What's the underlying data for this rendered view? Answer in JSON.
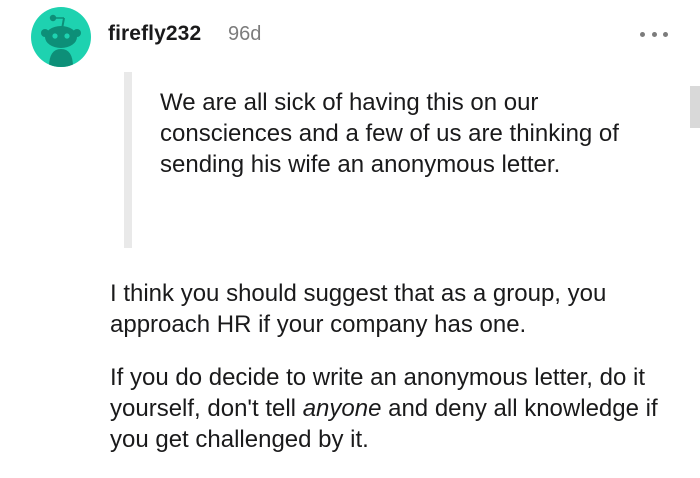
{
  "comment": {
    "username": "firefly232",
    "age": "96d",
    "avatar_icon": "snoo-avatar-icon",
    "avatar_color": "#1ed2b0",
    "more_icon": "more-options-icon",
    "quote": "We are all sick of having this on our consciences and a few of us are thinking of sending his wife an anonymous letter.",
    "paragraph1": "I think you should suggest that as a group, you approach HR if your company has one.",
    "paragraph2": {
      "before": "If you do decide to write an anonymous letter, do it yourself, don't tell ",
      "emphasis": "anyone",
      "after": " and deny all knowledge if you get challenged by it."
    }
  }
}
